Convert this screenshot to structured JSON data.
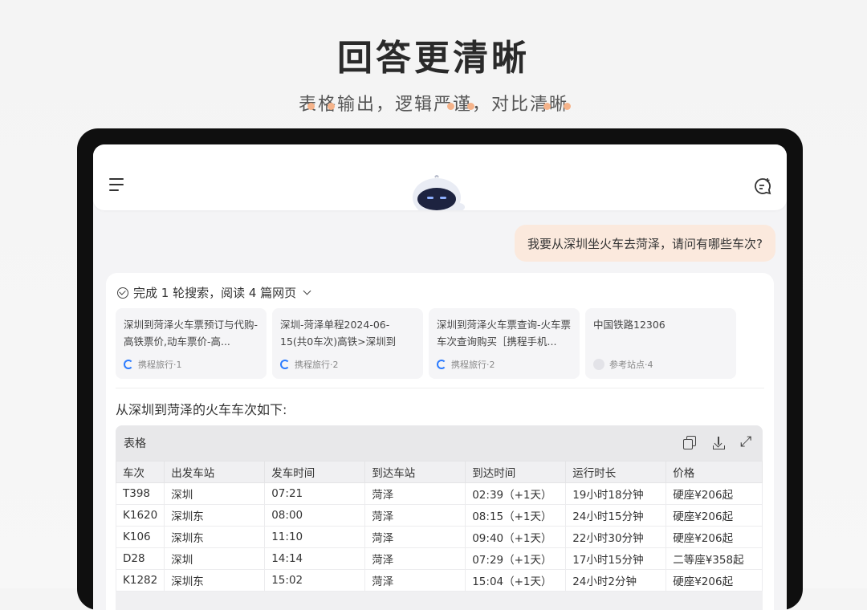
{
  "promo": {
    "title": "回答更清晰",
    "subtitle": "表格输出，逻辑严谨，对比清晰"
  },
  "colors": {
    "accent": "#f5b38a",
    "bubble": "#fbe9dd",
    "link_icon": "#2b7bff"
  },
  "header": {
    "menu_icon": "menu-icon",
    "mascot": "robot-mascot",
    "new_chat_icon": "new-chat-icon"
  },
  "user_message": "我要从深圳坐火车去菏泽，请问有哪些车次?",
  "search": {
    "summary": "完成 1 轮搜索，阅读 4 篇网页"
  },
  "sources": [
    {
      "title": "深圳到菏泽火车票预订与代购-高铁票价,动车票价-高...",
      "site": "携程旅行·1",
      "icon": "ctrip-icon"
    },
    {
      "title": "深圳-菏泽单程2024-06-15(共0车次)高铁>深圳到菏...",
      "site": "携程旅行·2",
      "icon": "ctrip-icon"
    },
    {
      "title": "深圳到菏泽火车票查询-火车票车次查询购买［携程手机...",
      "site": "携程旅行·2",
      "icon": "ctrip-icon"
    },
    {
      "title": "中国铁路12306",
      "site": "参考站点·4",
      "icon": "reference-icon"
    }
  ],
  "answer": {
    "intro": "从深圳到菏泽的火车车次如下:"
  },
  "table": {
    "label": "表格",
    "columns": [
      "车次",
      "出发车站",
      "发车时间",
      "到达车站",
      "到达时间",
      "运行时长",
      "价格"
    ],
    "rows": [
      [
        "T398",
        "深圳",
        "07:21",
        "菏泽",
        "02:39（+1天）",
        "19小时18分钟",
        "硬座¥206起"
      ],
      [
        "K1620",
        "深圳东",
        "08:00",
        "菏泽",
        "08:15（+1天）",
        "24小时15分钟",
        "硬座¥206起"
      ],
      [
        "K106",
        "深圳东",
        "11:10",
        "菏泽",
        "09:40（+1天）",
        "22小时30分钟",
        "硬座¥206起"
      ],
      [
        "D28",
        "深圳",
        "14:14",
        "菏泽",
        "07:29（+1天）",
        "17小时15分钟",
        "二等座¥358起"
      ],
      [
        "K1282",
        "深圳东",
        "15:02",
        "菏泽",
        "15:04（+1天）",
        "24小时2分钟",
        "硬座¥206起"
      ]
    ]
  }
}
